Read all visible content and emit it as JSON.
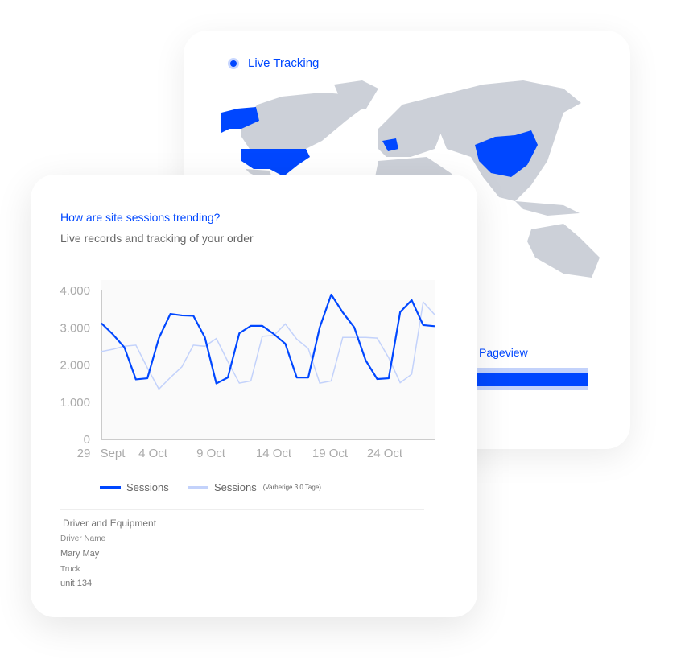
{
  "map_card": {
    "live_label": "Live Tracking",
    "highlighted_regions": [
      "Alaska",
      "United States",
      "France",
      "China"
    ],
    "pageview_label": "Pageview",
    "pageview_bars": [
      {
        "level": 1.0
      },
      {
        "level": 0.13
      }
    ],
    "colors": {
      "accent": "#0047ff",
      "land": "#ccd0d8",
      "bar_bg": "#c3d2fb"
    }
  },
  "chart_card": {
    "title": "How are site sessions trending?",
    "subtitle": "Live records and tracking of your order",
    "legend": [
      {
        "label": "Sessions",
        "note": ""
      },
      {
        "label": "Sessions",
        "note": "(Varherige 3.0 Tage)"
      }
    ],
    "section_title": "Driver and Equipment",
    "fields": [
      {
        "label": "Driver Name",
        "value": "Mary May"
      },
      {
        "label": "Truck",
        "value": "unit 134"
      }
    ]
  },
  "chart_data": {
    "type": "line",
    "x": [
      "29 Sept",
      "30 Sept",
      "1 Oct",
      "2 Oct",
      "3 Oct",
      "4 Oct",
      "5 Oct",
      "6 Oct",
      "7 Oct",
      "8 Oct",
      "9 Oct",
      "10 Oct",
      "11 Oct",
      "12 Oct",
      "13 Oct",
      "14 Oct",
      "15 Oct",
      "16 Oct",
      "17 Oct",
      "18 Oct",
      "19 Oct",
      "20 Oct",
      "21 Oct",
      "22 Oct",
      "23 Oct",
      "24 Oct",
      "25 Oct",
      "26 Oct",
      "27 Oct",
      "28 Oct"
    ],
    "x_tick_labels": [
      "29",
      "Sept",
      "4  Oct",
      "9  Oct",
      "14 Oct",
      "19 Oct",
      "24 Oct"
    ],
    "y_tick_labels": [
      "0",
      "1.000",
      "2.000",
      "3.000",
      "4.000"
    ],
    "ylim": [
      0,
      4000
    ],
    "series": [
      {
        "name": "Sessions",
        "color": "#0047ff",
        "values": [
          3100,
          2800,
          2450,
          1590,
          1620,
          2700,
          3350,
          3310,
          3300,
          2720,
          1480,
          1640,
          2830,
          3030,
          3030,
          2810,
          2550,
          1640,
          1640,
          2990,
          3870,
          3390,
          2990,
          2100,
          1600,
          1620,
          3400,
          3720,
          3050,
          3020
        ]
      },
      {
        "name": "Sessions (Varherige 3.0 Tage)",
        "color": "#c3d2fb",
        "values": [
          2340,
          2400,
          2480,
          2510,
          1900,
          1330,
          1640,
          1930,
          2510,
          2480,
          2690,
          2070,
          1490,
          1550,
          2750,
          2770,
          3080,
          2670,
          2420,
          1490,
          1550,
          2720,
          2720,
          2720,
          2700,
          2170,
          1500,
          1730,
          3670,
          3330
        ]
      }
    ],
    "grid": false,
    "legend_position": "bottom"
  }
}
